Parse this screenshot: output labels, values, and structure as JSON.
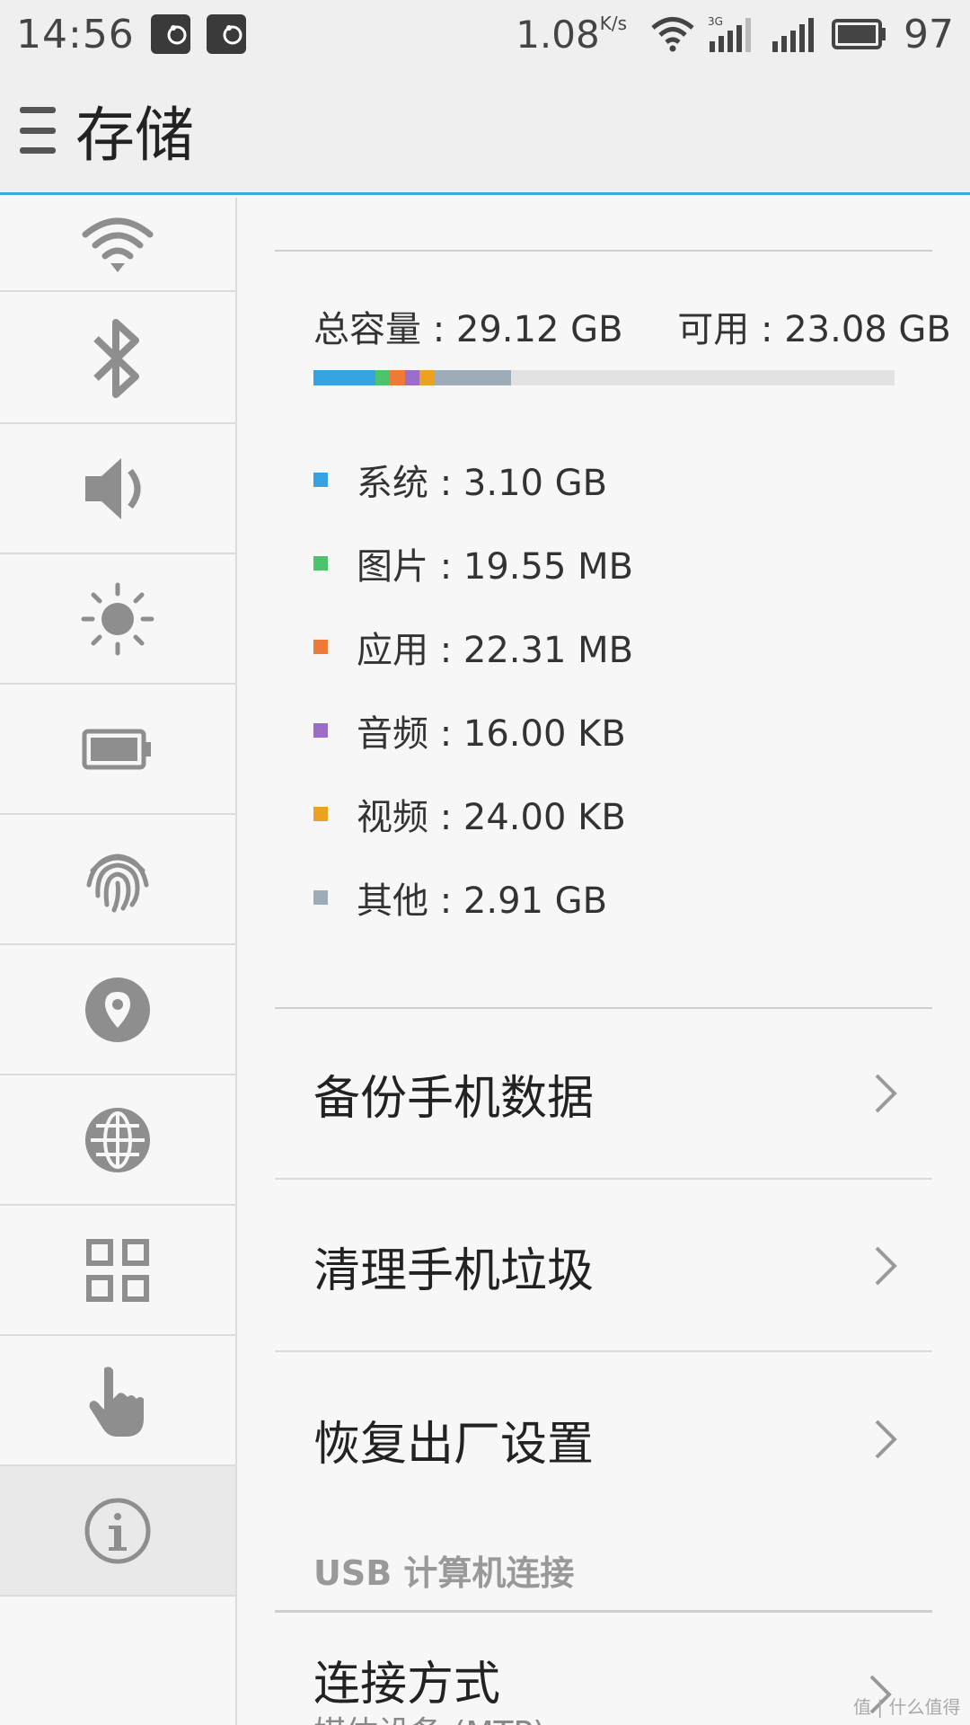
{
  "status_bar": {
    "time": "14:56",
    "net_speed": "1.08",
    "net_speed_unit": "K/s",
    "battery_percent": "97",
    "network_type": "3G"
  },
  "header": {
    "title": "存储"
  },
  "sidebar": {
    "items": [
      {
        "icon": "wifi-icon"
      },
      {
        "icon": "bluetooth-icon"
      },
      {
        "icon": "speaker-icon"
      },
      {
        "icon": "brightness-icon"
      },
      {
        "icon": "battery-icon"
      },
      {
        "icon": "fingerprint-icon"
      },
      {
        "icon": "location-icon"
      },
      {
        "icon": "globe-icon"
      },
      {
        "icon": "apps-grid-icon"
      },
      {
        "icon": "hand-pointer-icon"
      },
      {
        "icon": "info-icon",
        "active": true
      }
    ]
  },
  "storage": {
    "total": "总容量 : 29.12 GB",
    "available": "可用 : 23.08 GB",
    "total_gb": 29.12,
    "available_gb": 23.08,
    "categories": [
      {
        "label": "系统 : 3.10 GB",
        "color": "#36a3e0",
        "fraction": 0.1065
      },
      {
        "label": "图片 : 19.55 MB",
        "color": "#4cc46e",
        "fraction": 0.0255
      },
      {
        "label": "应用 : 22.31 MB",
        "color": "#ef7a36",
        "fraction": 0.0255
      },
      {
        "label": "音频 : 16.00 KB",
        "color": "#9b6dc9",
        "fraction": 0.0255
      },
      {
        "label": "视频 : 24.00 KB",
        "color": "#eba221",
        "fraction": 0.0255
      },
      {
        "label": "其他 : 2.91 GB",
        "color": "#9eacb7",
        "fraction": 0.1314
      }
    ]
  },
  "menu": {
    "backup": "备份手机数据",
    "cleanup": "清理手机垃圾",
    "factory_reset": "恢复出厂设置"
  },
  "usb": {
    "section_label": "USB 计算机连接",
    "connection_title": "连接方式",
    "connection_value": "媒体设备 (MTP)"
  },
  "watermark": "值 | 什么值得买"
}
